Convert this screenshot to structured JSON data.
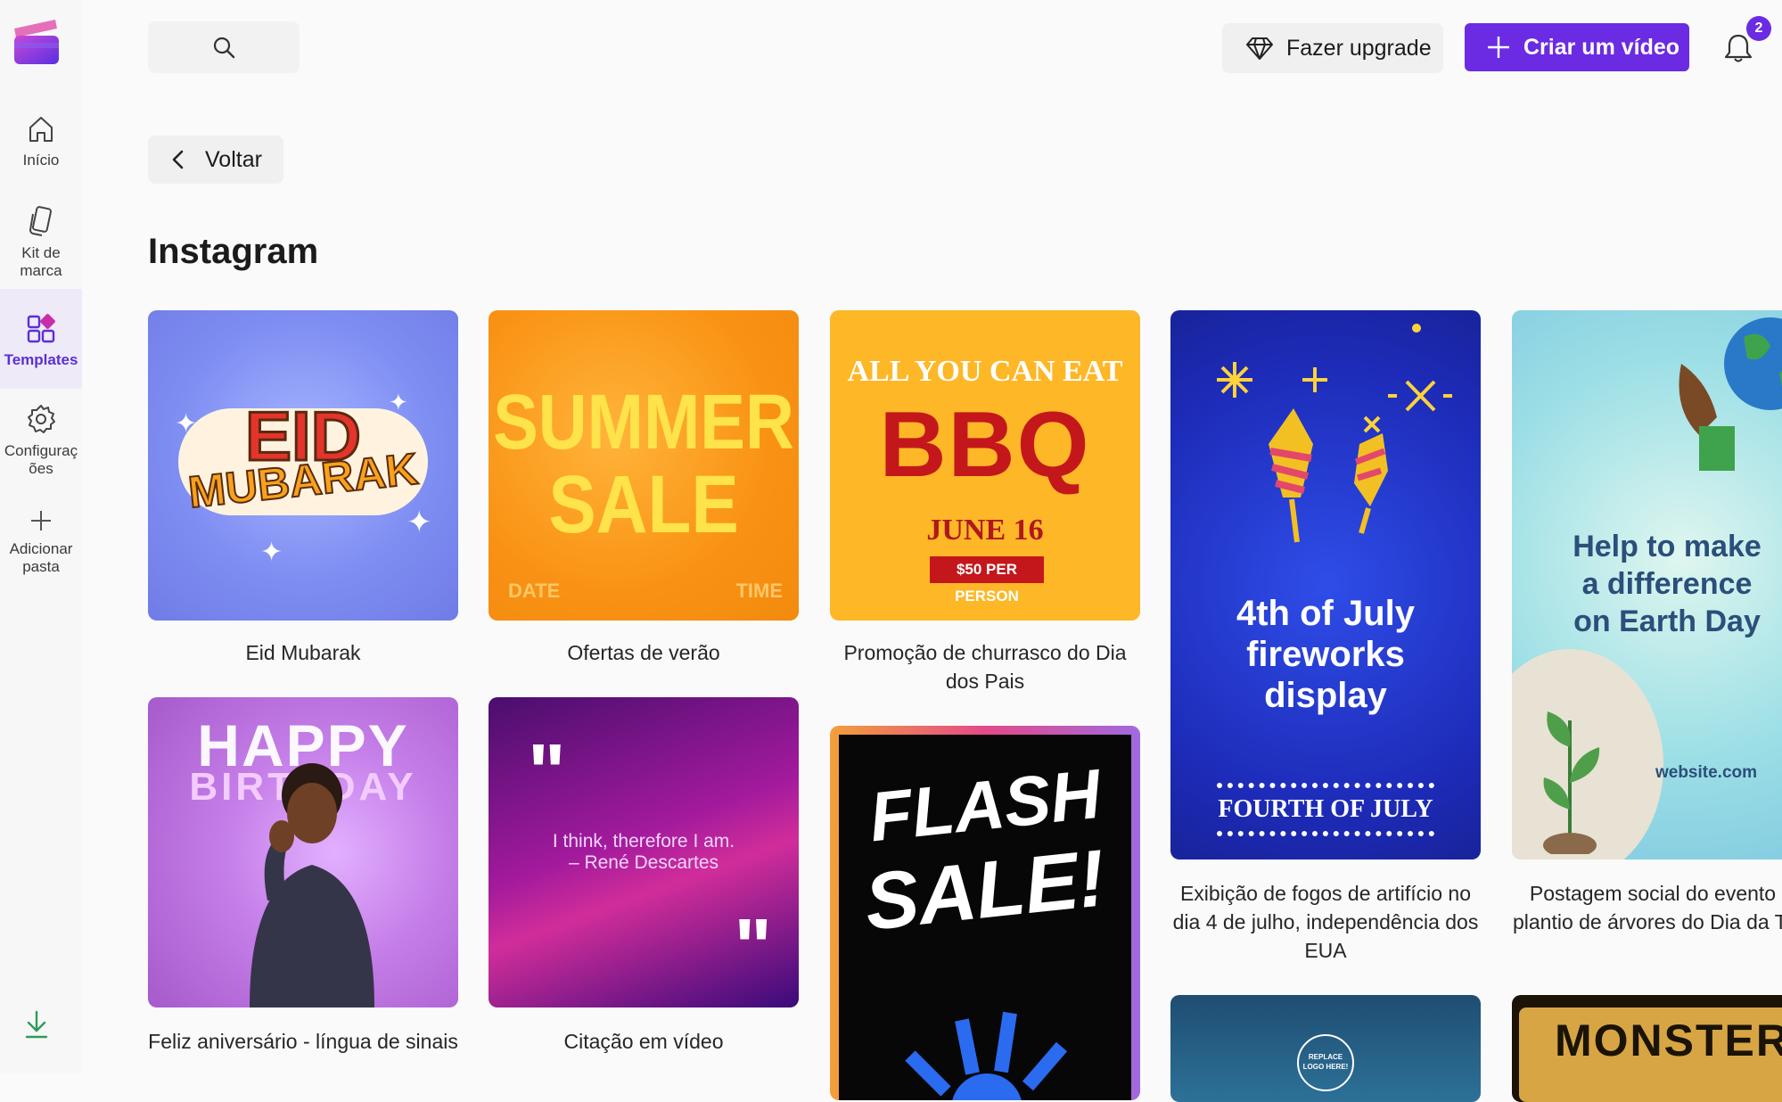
{
  "sidebar": {
    "items": [
      {
        "label": "Início",
        "icon": "home-icon"
      },
      {
        "label": "Kit de marca",
        "icon": "brand-kit-icon"
      },
      {
        "label": "Templates",
        "icon": "templates-icon"
      },
      {
        "label": "Configurações",
        "icon": "gear-icon"
      },
      {
        "label": "Adicionar pasta",
        "icon": "plus-icon"
      }
    ]
  },
  "header": {
    "upgrade_label": "Fazer upgrade",
    "create_label": "Criar um vídeo",
    "notification_count": "2"
  },
  "back_label": "Voltar",
  "page_title": "Instagram",
  "colors": {
    "accent": "#6b2be3"
  },
  "templates": [
    {
      "caption": "Eid Mubarak",
      "thumb_lines": [
        "EID",
        "MUBARAK"
      ]
    },
    {
      "caption": "Ofertas de verão",
      "thumb_lines": [
        "SUMMER",
        "SALE",
        "DATE",
        "TIME"
      ]
    },
    {
      "caption": "Promoção de churrasco do Dia dos Pais",
      "thumb_lines": [
        "ALL YOU CAN EAT",
        "BBQ",
        "JUNE 16",
        "$50 PER PERSON"
      ]
    },
    {
      "caption": "Exibição de fogos de artifício no dia 4 de julho, independência dos EUA",
      "thumb_lines": [
        "4th of July",
        "fireworks",
        "display",
        "FOURTH OF JULY"
      ]
    },
    {
      "caption": "Postagem social do evento de plantio de árvores do Dia da Terra",
      "thumb_lines": [
        "Help to make",
        "a difference",
        "on Earth Day",
        "website.com"
      ]
    },
    {
      "caption": "Feliz aniversário - língua de sinais",
      "thumb_lines": [
        "HAPPY",
        "BIRTHDAY"
      ]
    },
    {
      "caption": "Citação em vídeo",
      "thumb_lines": [
        "I think, therefore I am.",
        "– René Descartes"
      ]
    },
    {
      "caption": "",
      "thumb_lines": [
        "FLASH",
        "SALE!"
      ]
    },
    {
      "caption": "",
      "thumb_lines": [
        "REPLACE",
        "LOGO HERE!"
      ]
    },
    {
      "caption": "",
      "thumb_lines": [
        "MONSTER"
      ]
    }
  ]
}
